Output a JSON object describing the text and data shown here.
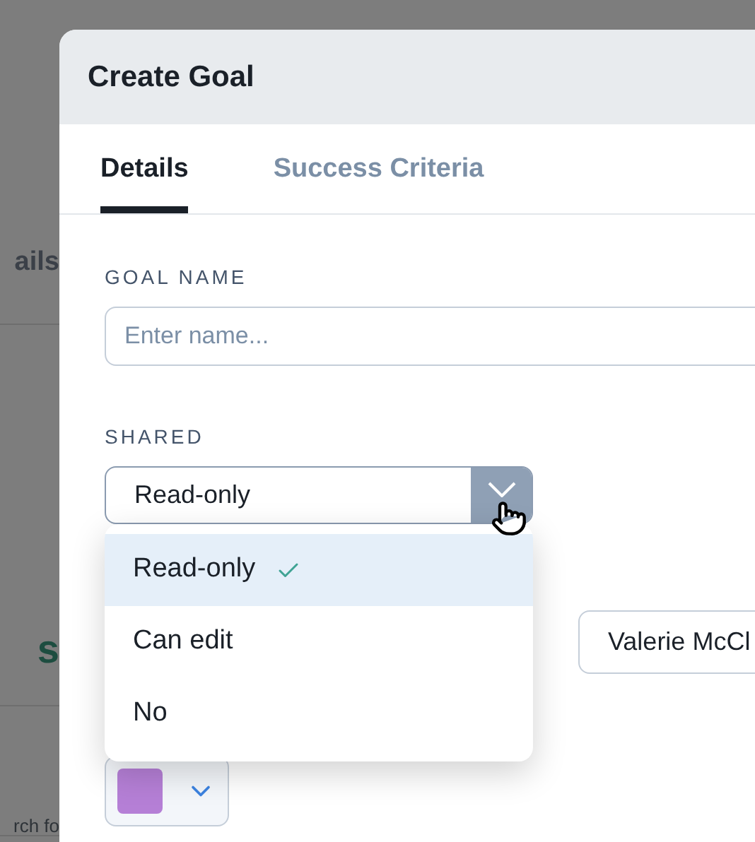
{
  "background": {
    "texts": [
      {
        "text": "ails",
        "kind": "heading"
      },
      {
        "text": "s",
        "kind": "accent"
      },
      {
        "text": "rch fo",
        "kind": "hint"
      }
    ]
  },
  "dialog": {
    "title": "Create Goal",
    "tabs": [
      {
        "label": "Details",
        "selected": true
      },
      {
        "label": "Success Criteria",
        "selected": false
      }
    ],
    "goal_name": {
      "label": "GOAL NAME",
      "placeholder": "Enter name..."
    },
    "shared": {
      "label": "SHARED",
      "value": "Read-only",
      "expanded": true,
      "options": [
        {
          "label": "Read-only",
          "selected": true
        },
        {
          "label": "Can edit",
          "selected": false
        },
        {
          "label": "No",
          "selected": false
        }
      ]
    },
    "owner": {
      "value": "Valerie McCl"
    },
    "color": {
      "color": "#b57fd6"
    }
  }
}
